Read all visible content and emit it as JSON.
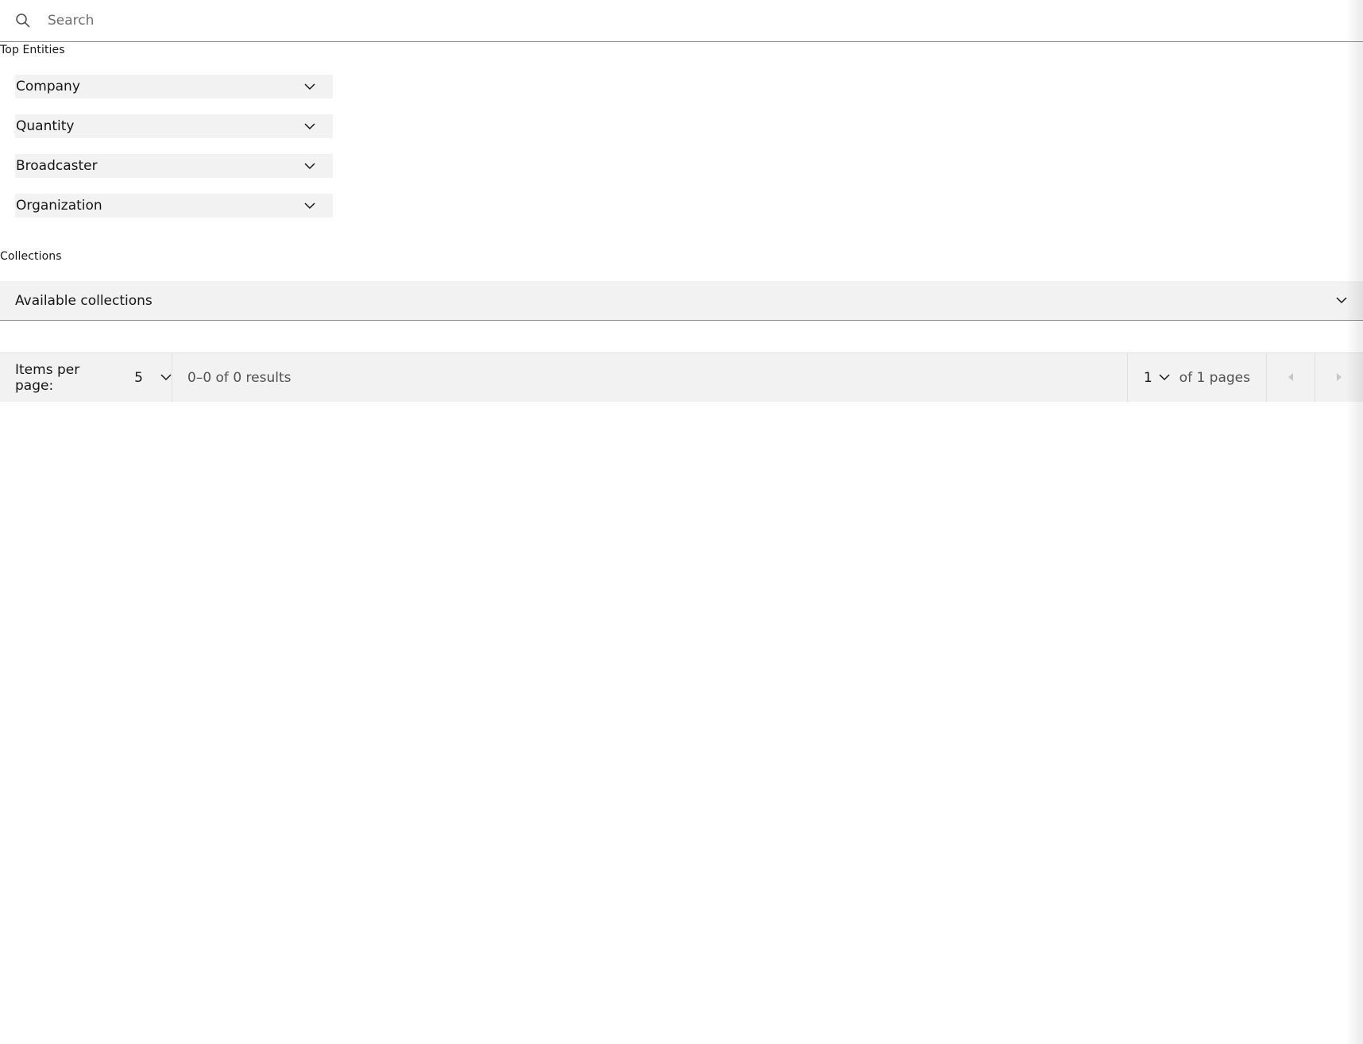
{
  "search": {
    "placeholder": "Search",
    "value": "",
    "icon": "search-icon"
  },
  "top_entities": {
    "heading": "Top Entities",
    "items": [
      {
        "label": "Company",
        "icon": "chevron-down-icon"
      },
      {
        "label": "Quantity",
        "icon": "chevron-down-icon"
      },
      {
        "label": "Broadcaster",
        "icon": "chevron-down-icon"
      },
      {
        "label": "Organization",
        "icon": "chevron-down-icon"
      }
    ]
  },
  "collections": {
    "heading": "Collections",
    "dropdown_label": "Available collections",
    "icon": "chevron-down-icon"
  },
  "pagination": {
    "items_per_page_label": "Items per page:",
    "items_per_page_value": "5",
    "range_text": "0–0 of 0 results",
    "current_page": "1",
    "of_pages_text": "of 1 pages",
    "prev_icon": "caret-left-icon",
    "next_icon": "caret-right-icon"
  },
  "colors": {
    "field_bg": "#f2f2f2",
    "text_primary": "#161616",
    "text_secondary": "#525252",
    "border": "#8d8d8d",
    "disabled_icon": "#c6c6c6"
  }
}
